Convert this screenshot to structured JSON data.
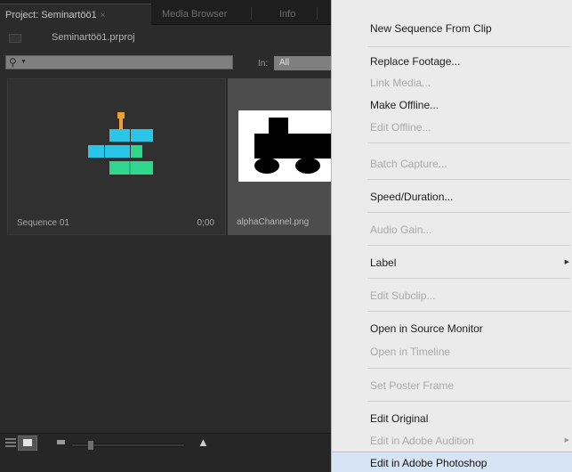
{
  "project_panel": {
    "tabs": [
      {
        "label": "Project: Seminartöö1",
        "close": "×"
      },
      {
        "label": "Media Browser"
      },
      {
        "label": "Info"
      }
    ],
    "project_file": "Seminartöö1.prproj",
    "search": {
      "placeholder": ""
    },
    "in_label": "In:",
    "in_value": "All",
    "items": [
      {
        "name": "Sequence 01",
        "duration": "0;00"
      },
      {
        "name": "alphaChannel.png"
      }
    ],
    "zoom_level": 0.15
  },
  "context_menu": {
    "items": [
      {
        "label": "New Sequence From Clip",
        "enabled": true
      },
      {
        "label": "Replace Footage...",
        "enabled": true
      },
      {
        "label": "Link Media...",
        "enabled": false
      },
      {
        "label": "Make Offline...",
        "enabled": true
      },
      {
        "label": "Edit Offline...",
        "enabled": false
      },
      {
        "label": "Batch Capture...",
        "enabled": false
      },
      {
        "label": "Speed/Duration...",
        "enabled": true
      },
      {
        "label": "Audio Gain...",
        "enabled": false
      },
      {
        "label": "Label",
        "enabled": true,
        "submenu": true
      },
      {
        "label": "Edit Subclip...",
        "enabled": false
      },
      {
        "label": "Open in Source Monitor",
        "enabled": true
      },
      {
        "label": "Open in Timeline",
        "enabled": false
      },
      {
        "label": "Set Poster Frame",
        "enabled": false
      },
      {
        "label": "Edit Original",
        "enabled": true
      },
      {
        "label": "Edit in Adobe Audition",
        "enabled": false,
        "submenu": true
      },
      {
        "label": "Edit in Adobe Photoshop",
        "enabled": true,
        "highlighted": true
      }
    ],
    "submenu_arrow": "▶"
  },
  "colors": {
    "panel_bg": "#2b2b2b",
    "menu_bg": "#ebebeb",
    "menu_highlight": "#d6e4f5",
    "sequence_icon_cyan": "#29c6e8",
    "sequence_icon_green": "#2fd68c",
    "sequence_icon_orange": "#f0a030"
  }
}
